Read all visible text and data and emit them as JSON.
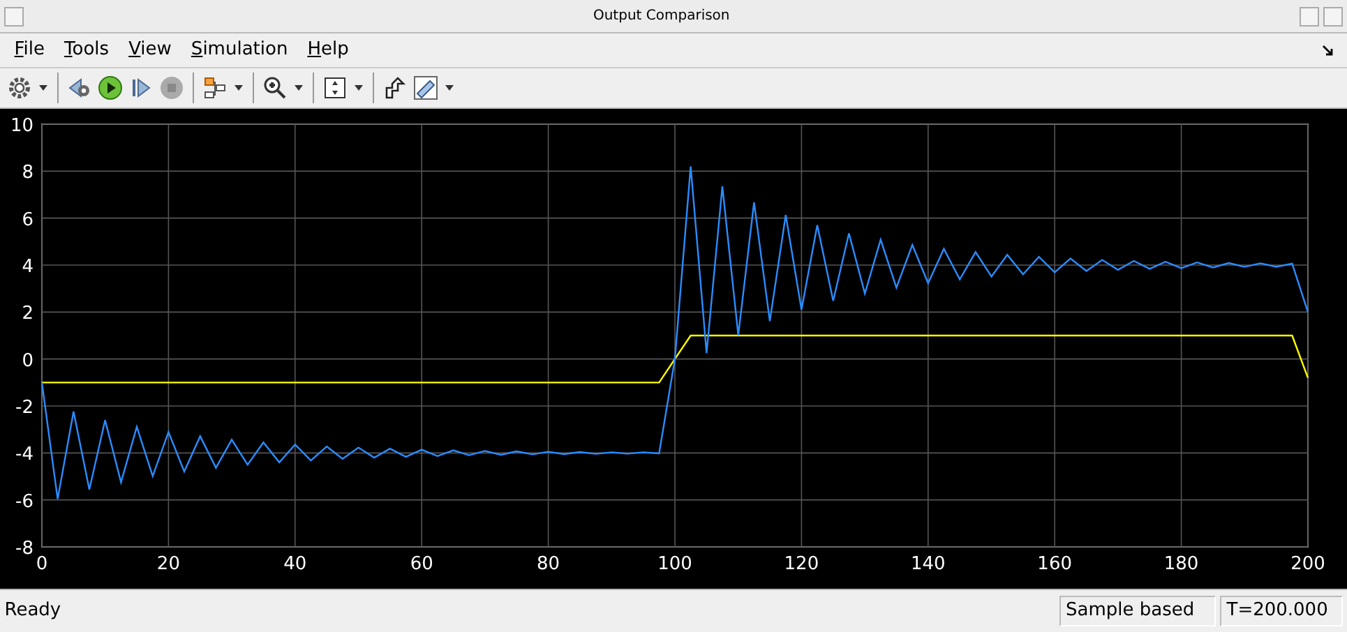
{
  "window": {
    "title": "Output Comparison"
  },
  "menu": [
    {
      "label": "File"
    },
    {
      "label": "Tools"
    },
    {
      "label": "View"
    },
    {
      "label": "Simulation"
    },
    {
      "label": "Help"
    }
  ],
  "toolbar": [
    {
      "kind": "gear"
    },
    {
      "kind": "caret"
    },
    {
      "kind": "separator"
    },
    {
      "kind": "step-back"
    },
    {
      "kind": "run"
    },
    {
      "kind": "step-forward"
    },
    {
      "kind": "stop"
    },
    {
      "kind": "separator"
    },
    {
      "kind": "blocks"
    },
    {
      "kind": "caret"
    },
    {
      "kind": "separator"
    },
    {
      "kind": "zoom"
    },
    {
      "kind": "caret"
    },
    {
      "kind": "separator"
    },
    {
      "kind": "scale"
    },
    {
      "kind": "caret"
    },
    {
      "kind": "separator"
    },
    {
      "kind": "highlight"
    },
    {
      "kind": "ruler"
    },
    {
      "kind": "caret"
    }
  ],
  "plot": {
    "chart_data": {
      "type": "line",
      "grid": true,
      "x": [
        0,
        2.5,
        5,
        7.5,
        10,
        12.5,
        15,
        17.5,
        20,
        22.5,
        25,
        27.5,
        30,
        32.5,
        35,
        37.5,
        40,
        42.5,
        45,
        47.5,
        50,
        52.5,
        55,
        57.5,
        60,
        62.5,
        65,
        67.5,
        70,
        72.5,
        75,
        77.5,
        80,
        82.5,
        85,
        87.5,
        90,
        92.5,
        95,
        97.5,
        100,
        102.5,
        105,
        107.5,
        110,
        112.5,
        115,
        117.5,
        120,
        122.5,
        125,
        127.5,
        130,
        132.5,
        135,
        137.5,
        140,
        142.5,
        145,
        147.5,
        150,
        152.5,
        155,
        157.5,
        160,
        162.5,
        165,
        167.5,
        170,
        172.5,
        175,
        177.5,
        180,
        182.5,
        185,
        187.5,
        190,
        192.5,
        195,
        197.5,
        200
      ],
      "series": [
        {
          "color": "#ffff00",
          "values": [
            -1,
            -1,
            -1,
            -1,
            -1,
            -1,
            -1,
            -1,
            -1,
            -1,
            -1,
            -1,
            -1,
            -1,
            -1,
            -1,
            -1,
            -1,
            -1,
            -1,
            -1,
            -1,
            -1,
            -1,
            -1,
            -1,
            -1,
            -1,
            -1,
            -1,
            -1,
            -1,
            -1,
            -1,
            -1,
            -1,
            -1,
            -1,
            -1,
            -1,
            0,
            1,
            1,
            1,
            1,
            1,
            1,
            1,
            1,
            1,
            1,
            1,
            1,
            1,
            1,
            1,
            1,
            1,
            1,
            1,
            1,
            1,
            1,
            1,
            1,
            1,
            1,
            1,
            1,
            1,
            1,
            1,
            1,
            1,
            1,
            1,
            1,
            1,
            1,
            1,
            -0.8
          ]
        },
        {
          "color": "#2a8cff",
          "values": [
            -1,
            -5.96,
            -2.24,
            -5.56,
            -2.6,
            -5.25,
            -2.89,
            -4.99,
            -3.11,
            -4.79,
            -3.29,
            -4.63,
            -3.44,
            -4.5,
            -3.55,
            -4.4,
            -3.64,
            -4.32,
            -3.72,
            -4.25,
            -3.77,
            -4.2,
            -3.82,
            -4.16,
            -3.86,
            -4.13,
            -3.89,
            -4.1,
            -3.91,
            -4.08,
            -3.93,
            -4.06,
            -3.95,
            -4.05,
            -3.96,
            -4.04,
            -3.97,
            -4.03,
            -3.97,
            -4.02,
            0,
            8.2,
            0.25,
            7.35,
            1.01,
            6.67,
            1.61,
            6.13,
            2.1,
            5.7,
            2.48,
            5.35,
            2.79,
            5.08,
            3.04,
            4.86,
            3.23,
            4.69,
            3.39,
            4.55,
            3.51,
            4.44,
            3.61,
            4.35,
            3.69,
            4.28,
            3.75,
            4.22,
            3.8,
            4.18,
            3.84,
            4.14,
            3.87,
            4.11,
            3.9,
            4.09,
            3.92,
            4.08,
            3.93,
            4.06,
            2
          ]
        }
      ],
      "xlim": [
        0,
        200
      ],
      "ylim": [
        -8,
        10
      ],
      "xticks": [
        0,
        20,
        40,
        60,
        80,
        100,
        120,
        140,
        160,
        180,
        200
      ],
      "yticks": [
        -8,
        -6,
        -4,
        -2,
        0,
        2,
        4,
        6,
        8,
        10
      ]
    }
  },
  "status_bar": {
    "message": "Ready",
    "mode": "Sample based",
    "time": "T=200.000"
  }
}
